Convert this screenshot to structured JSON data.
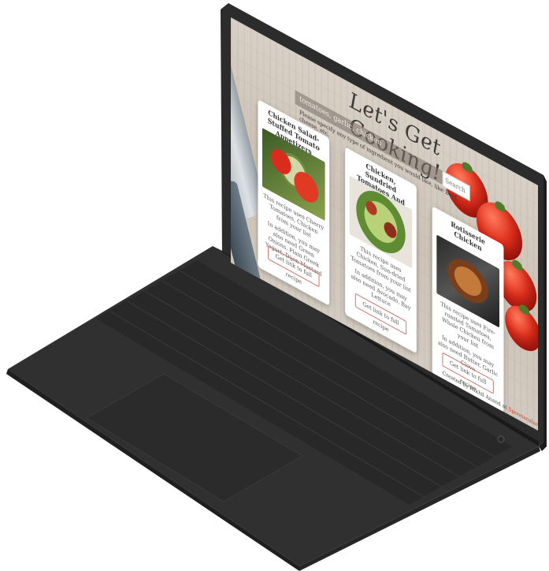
{
  "page": {
    "title": "Let's Get Cooking!",
    "ingredients_value": "tomatoes, garlic, chicken",
    "hint": "Please specify any type of ingredient you would like, like Beef, cheese, etc.",
    "search_label": "Search"
  },
  "recipes": [
    {
      "title": "Chicken Salad-Stuffed Tomato Appetizers",
      "text1": "This recipe uses Cherry Tomatoes, Chicken from your list",
      "text2": "In addition, you may also need Green Onions, Plain Greek Yogurt, Dijon Mustard",
      "link": "Get link to full recipe"
    },
    {
      "title": "Chicken, Sundried Tomatoes And Lettuce",
      "text1": "This recipe uses Chicken, Sun-dried Tomatoes from your list",
      "text2": "In addition, you may also need Avocado, Bay Lettuce",
      "link": "Get link to full recipe"
    },
    {
      "title": "Rotisserie Chicken",
      "text1": "This recipe uses Fire-roasted Tomatoes, Whole Chicken from your list",
      "text2": "In addition, you may also need Butter, Garlic Clove",
      "link": "Get link to full recipe"
    }
  ],
  "footer": {
    "credit": "Created by Nikhil Anand at",
    "link": "Spoonacular"
  },
  "colors": {
    "laptop_body": "#2f2f2f",
    "keys": "#262626",
    "accent": "#d23a25"
  }
}
